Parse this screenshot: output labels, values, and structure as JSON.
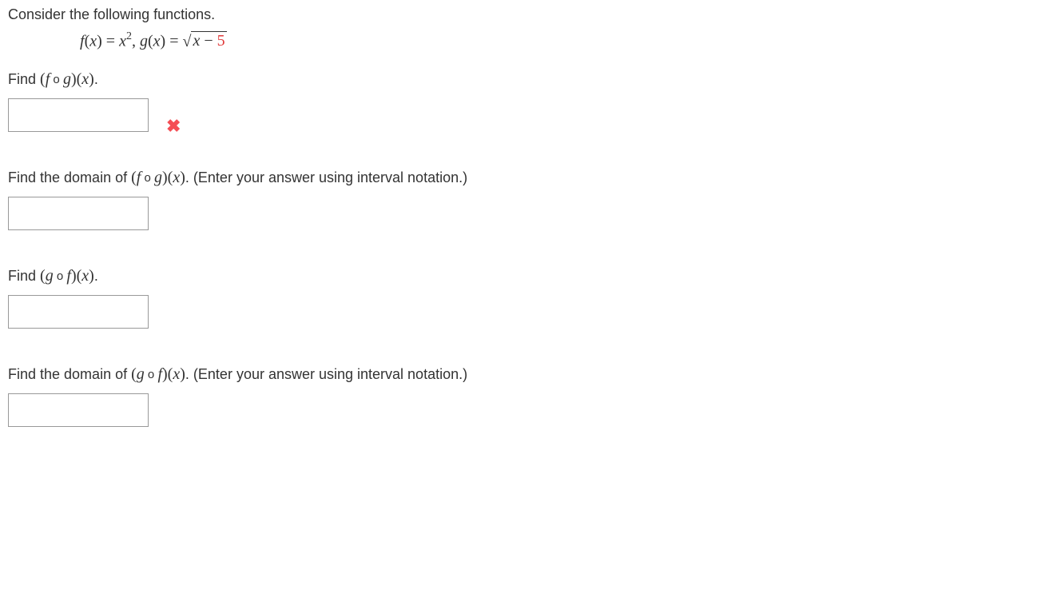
{
  "intro": "Consider the following functions.",
  "functions": {
    "f_lhs": "f",
    "f_paren_open": "(",
    "f_var": "x",
    "f_paren_close": ")",
    "eq": " = ",
    "f_rhs_base": "x",
    "f_rhs_exp": "2",
    "comma": ",   ",
    "g_lhs": "g",
    "g_var": "x",
    "sqrt_inner_var": "x",
    "sqrt_minus": " − ",
    "sqrt_const": "5"
  },
  "q1": {
    "prompt_prefix": "Find  ",
    "comp_left": "(f",
    "ring": " o ",
    "comp_right": "g)(x)",
    "period": ".",
    "status": "incorrect"
  },
  "q2": {
    "prompt_prefix": "Find the domain of  ",
    "comp_left": "(f",
    "ring": " o ",
    "comp_right": "g)(x)",
    "period": ".",
    "note": "  (Enter your answer using interval notation.)"
  },
  "q3": {
    "prompt_prefix": "Find  ",
    "comp_left": "(g",
    "ring": " o ",
    "comp_right": "f)(x)",
    "period": "."
  },
  "q4": {
    "prompt_prefix": "Find the domain of  ",
    "comp_left": "(g",
    "ring": " o ",
    "comp_right": "f)(x)",
    "period": ".",
    "note": "  (Enter your answer using interval notation.)"
  },
  "icons": {
    "incorrect_glyph": "✖"
  }
}
